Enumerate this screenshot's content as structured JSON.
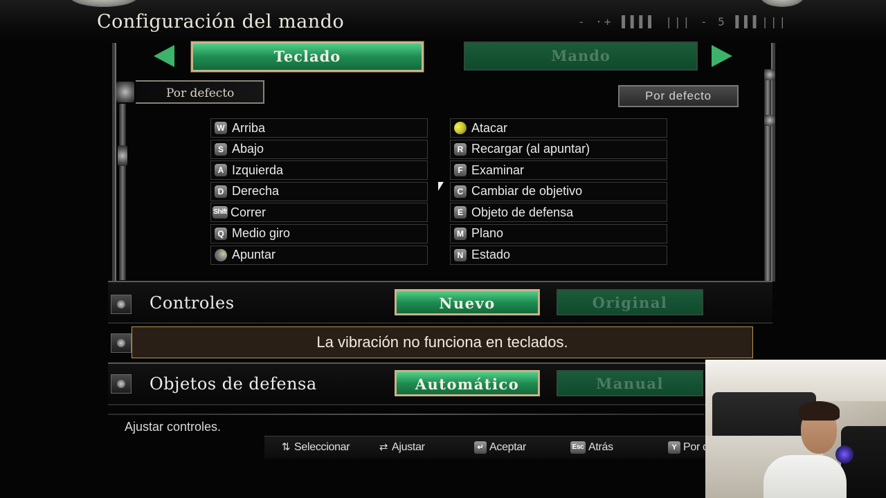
{
  "header": {
    "title": "Configuración del mando",
    "deco_text": "- ·+ ▌▌▌▌ |||   -  5  ▌▌▌|||"
  },
  "tabs": {
    "keyboard_label": "Teclado",
    "controller_label": "Mando",
    "active": "Teclado"
  },
  "preset": {
    "current_label": "Por defecto",
    "button_label": "Por defecto"
  },
  "bindings_left": [
    {
      "key": "W",
      "action": "Arriba"
    },
    {
      "key": "S",
      "action": "Abajo"
    },
    {
      "key": "A",
      "action": "Izquierda"
    },
    {
      "key": "D",
      "action": "Derecha"
    },
    {
      "key": "Shift",
      "action": "Correr"
    },
    {
      "key": "Q",
      "action": "Medio giro"
    },
    {
      "key": "mouse-right-icon",
      "action": "Apuntar"
    }
  ],
  "bindings_right": [
    {
      "key": "mouse-left-icon",
      "action": "Atacar"
    },
    {
      "key": "R",
      "action": "Recargar (al apuntar)"
    },
    {
      "key": "F",
      "action": "Examinar"
    },
    {
      "key": "C",
      "action": "Cambiar de objetivo"
    },
    {
      "key": "E",
      "action": "Objeto de defensa"
    },
    {
      "key": "M",
      "action": "Plano"
    },
    {
      "key": "N",
      "action": "Estado"
    }
  ],
  "controles": {
    "label": "Controles",
    "option_new": "Nuevo",
    "option_original": "Original",
    "selected": "Nuevo"
  },
  "vibration_message": "La vibración no funciona en teclados.",
  "objetos_defensa": {
    "label": "Objetos de defensa",
    "option_auto": "Automático",
    "option_manual": "Manual",
    "selected": "Automático"
  },
  "hint": "Ajustar controles.",
  "controls_bar": [
    {
      "icon": "updown-arrows-icon",
      "label": "Seleccionar"
    },
    {
      "icon": "leftright-arrows-icon",
      "label": "Ajustar"
    },
    {
      "key": "↵",
      "label": "Aceptar"
    },
    {
      "key": "Esc",
      "label": "Atrás"
    },
    {
      "key": "Y",
      "label": "Por defecto"
    }
  ],
  "colors": {
    "accent_green": "#1f8d52",
    "inactive_green": "#0f4a2c",
    "gold_border": "#c9b48a",
    "message_bg": "#2a1f17"
  }
}
